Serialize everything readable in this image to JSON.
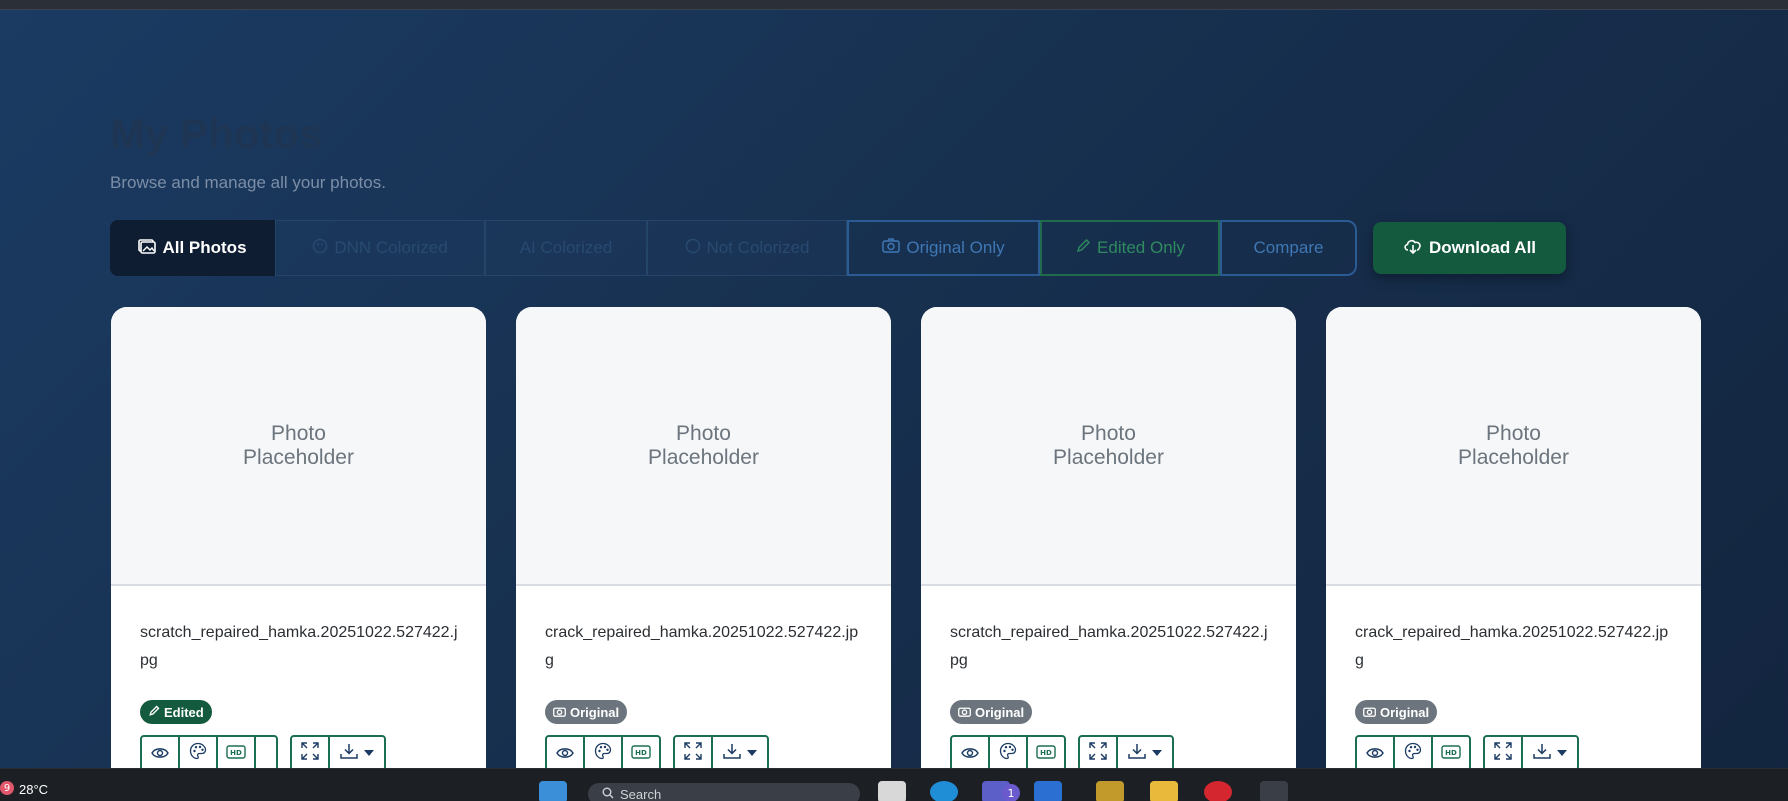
{
  "page": {
    "title": "My Photos",
    "subtitle": "Browse and manage all your photos."
  },
  "filters": [
    {
      "label": "All Photos",
      "icon": "images-icon",
      "state": "active"
    },
    {
      "label": "DNN Colorized",
      "icon": "palette-icon",
      "state": "faded"
    },
    {
      "label": "AI Colorized",
      "icon": "",
      "state": "faded"
    },
    {
      "label": "Not Colorized",
      "icon": "circle-icon",
      "state": "faded"
    },
    {
      "label": "Original Only",
      "icon": "camera-icon",
      "state": "outline-blue"
    },
    {
      "label": "Edited Only",
      "icon": "pencil-icon",
      "state": "outline-green"
    },
    {
      "label": "Compare",
      "icon": "",
      "state": "outline-blue"
    }
  ],
  "download_all": {
    "label": "Download All",
    "icon": "cloud-download-icon"
  },
  "photos": [
    {
      "placeholder": "Photo\nPlaceholder",
      "filename": "scratch_repaired_hamka.20251022.527422.jpg",
      "badge": "Edited",
      "badge_type": "edited"
    },
    {
      "placeholder": "Photo\nPlaceholder",
      "filename": "crack_repaired_hamka.20251022.527422.jpg",
      "badge": "Original",
      "badge_type": "original"
    },
    {
      "placeholder": "Photo\nPlaceholder",
      "filename": "scratch_repaired_hamka.20251022.527422.jpg",
      "badge": "Original",
      "badge_type": "original"
    },
    {
      "placeholder": "Photo\nPlaceholder",
      "filename": "crack_repaired_hamka.20251022.527422.jpg",
      "badge": "Original",
      "badge_type": "original"
    }
  ],
  "card_actions": [
    "eye-icon",
    "palette-icon",
    "hd-icon",
    "fullscreen-icon",
    "download-icon"
  ],
  "taskbar": {
    "weather_badge": "9",
    "temperature": "28°C",
    "search_placeholder": "Search",
    "notification_count": "1"
  },
  "colors": {
    "accent_green": "#145a3f",
    "accent_blue": "#2a5b93",
    "badge_gray": "#6c757d"
  }
}
